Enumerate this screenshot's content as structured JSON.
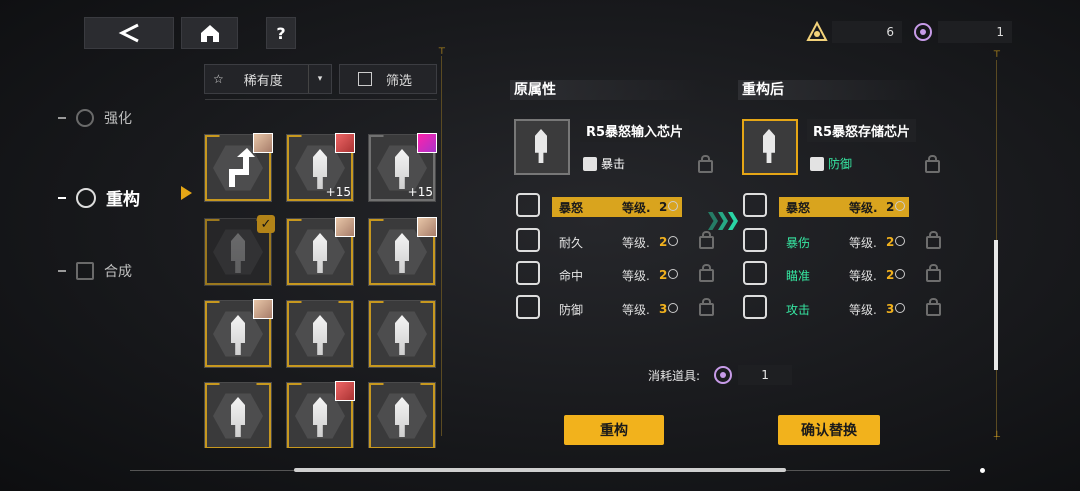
{
  "top": {
    "back_icon": "back-arrow-icon",
    "home_icon": "home-icon",
    "help_label": "?",
    "resource1_value": "6",
    "resource2_value": "1"
  },
  "nav": {
    "items": [
      {
        "label": "强化",
        "icon": "enhance-icon"
      },
      {
        "label": "重构",
        "icon": "reconstruct-icon"
      },
      {
        "label": "合成",
        "icon": "synthesize-icon"
      }
    ]
  },
  "sort": {
    "rarity_label": "稀有度",
    "filter_label": "筛选"
  },
  "grid": {
    "cells": [
      {
        "level": ""
      },
      {
        "level": "+15"
      },
      {
        "level": "+15"
      },
      {
        "level": ""
      },
      {
        "level": ""
      },
      {
        "level": ""
      },
      {
        "level": ""
      },
      {
        "level": ""
      },
      {
        "level": ""
      },
      {
        "level": ""
      },
      {
        "level": ""
      },
      {
        "level": ""
      }
    ]
  },
  "original": {
    "heading": "原属性",
    "chip_name": "R5暴怒输入芯片",
    "tag": "暴击",
    "rows": [
      {
        "name": "暴怒",
        "level_label": "等级.",
        "level": "2"
      },
      {
        "name": "耐久",
        "level_label": "等级.",
        "level": "2"
      },
      {
        "name": "命中",
        "level_label": "等级.",
        "level": "2"
      },
      {
        "name": "防御",
        "level_label": "等级.",
        "level": "3"
      }
    ]
  },
  "rebuilt": {
    "heading": "重构后",
    "chip_name": "R5暴怒存储芯片",
    "tag": "防御",
    "rows": [
      {
        "name": "暴怒",
        "level_label": "等级.",
        "level": "2"
      },
      {
        "name": "暴伤",
        "level_label": "等级.",
        "level": "2"
      },
      {
        "name": "瞄准",
        "level_label": "等级.",
        "level": "2"
      },
      {
        "name": "攻击",
        "level_label": "等级.",
        "level": "3"
      }
    ]
  },
  "cost": {
    "label": "消耗道具:",
    "value": "1"
  },
  "actions": {
    "reconstruct_label": "重构",
    "confirm_label": "确认替换"
  },
  "colors": {
    "accent": "#f2b21c",
    "highlight_green": "#36e7a2"
  }
}
